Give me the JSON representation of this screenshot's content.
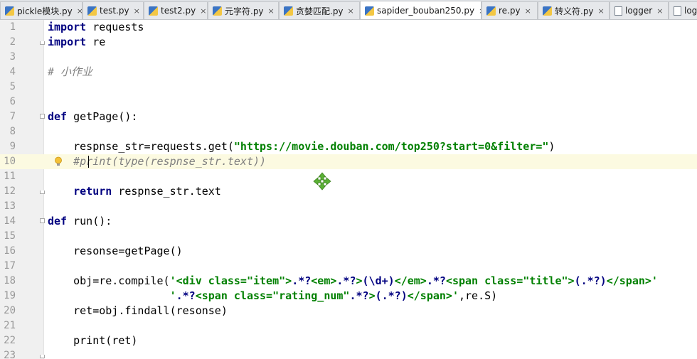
{
  "tabs": [
    {
      "label": "pickle模块.py",
      "type": "py",
      "active": false
    },
    {
      "label": "test.py",
      "type": "py",
      "active": false
    },
    {
      "label": "test2.py",
      "type": "py",
      "active": false
    },
    {
      "label": "元字符.py",
      "type": "py",
      "active": false
    },
    {
      "label": "贪婪匹配.py",
      "type": "py",
      "active": false
    },
    {
      "label": "sapider_bouban250.py",
      "type": "py",
      "active": true
    },
    {
      "label": "re.py",
      "type": "py",
      "active": false
    },
    {
      "label": "转义符.py",
      "type": "py",
      "active": false
    },
    {
      "label": "logger",
      "type": "file",
      "active": false
    },
    {
      "label": "log",
      "type": "file",
      "active": false
    }
  ],
  "tab_close_glyph": "×",
  "editor": {
    "current_line": 10,
    "lines": [
      {
        "n": "1",
        "segs": [
          {
            "t": "import",
            "c": "kw"
          },
          {
            "t": " requests",
            "c": ""
          }
        ]
      },
      {
        "n": "2",
        "segs": [
          {
            "t": "import",
            "c": "kw"
          },
          {
            "t": " re",
            "c": ""
          }
        ]
      },
      {
        "n": "3",
        "segs": []
      },
      {
        "n": "4",
        "segs": [
          {
            "t": "# 小作业",
            "c": "cmt"
          }
        ]
      },
      {
        "n": "5",
        "segs": []
      },
      {
        "n": "6",
        "segs": []
      },
      {
        "n": "7",
        "segs": [
          {
            "t": "def",
            "c": "kw"
          },
          {
            "t": " getPage():",
            "c": ""
          }
        ]
      },
      {
        "n": "8",
        "segs": []
      },
      {
        "n": "9",
        "segs": [
          {
            "t": "    respnse_str=requests.get(",
            "c": ""
          },
          {
            "t": "\"https://movie.douban.com/top250?start=0&filter=\"",
            "c": "str"
          },
          {
            "t": ")",
            "c": ""
          }
        ]
      },
      {
        "n": "10",
        "segs": [
          {
            "t": "    #print(type(respnse_str.text))",
            "c": "cmt"
          }
        ]
      },
      {
        "n": "11",
        "segs": []
      },
      {
        "n": "12",
        "segs": [
          {
            "t": "    ",
            "c": ""
          },
          {
            "t": "return",
            "c": "kw"
          },
          {
            "t": " respnse_str.text",
            "c": ""
          }
        ]
      },
      {
        "n": "13",
        "segs": []
      },
      {
        "n": "14",
        "segs": [
          {
            "t": "def",
            "c": "kw"
          },
          {
            "t": " run():",
            "c": ""
          }
        ]
      },
      {
        "n": "15",
        "segs": []
      },
      {
        "n": "16",
        "segs": [
          {
            "t": "    resonse=getPage()",
            "c": ""
          }
        ]
      },
      {
        "n": "17",
        "segs": []
      },
      {
        "n": "18",
        "segs": [
          {
            "t": "    obj=re.compile(",
            "c": ""
          },
          {
            "t": "'<div class=\"item\">",
            "c": "str"
          },
          {
            "t": ".*?",
            "c": "kw"
          },
          {
            "t": "<em>",
            "c": "str"
          },
          {
            "t": ".*?",
            "c": "kw"
          },
          {
            "t": ">",
            "c": "str"
          },
          {
            "t": "(\\d+)",
            "c": "kw"
          },
          {
            "t": "</em>",
            "c": "str"
          },
          {
            "t": ".*?",
            "c": "kw"
          },
          {
            "t": "<span class=\"title\">",
            "c": "str"
          },
          {
            "t": "(.*?)",
            "c": "kw"
          },
          {
            "t": "</span>'",
            "c": "str"
          }
        ]
      },
      {
        "n": "19",
        "segs": [
          {
            "t": "                   ",
            "c": ""
          },
          {
            "t": "'",
            "c": "str"
          },
          {
            "t": ".*?",
            "c": "kw"
          },
          {
            "t": "<span class=\"rating_num\"",
            "c": "str"
          },
          {
            "t": ".*?",
            "c": "kw"
          },
          {
            "t": ">",
            "c": "str"
          },
          {
            "t": "(.*?)",
            "c": "kw"
          },
          {
            "t": "</span>'",
            "c": "str"
          },
          {
            "t": ",re.S)",
            "c": ""
          }
        ]
      },
      {
        "n": "20",
        "segs": [
          {
            "t": "    ret=obj.findall(resonse)",
            "c": ""
          }
        ]
      },
      {
        "n": "21",
        "segs": []
      },
      {
        "n": "22",
        "segs": [
          {
            "t": "    print(ret)",
            "c": ""
          }
        ]
      },
      {
        "n": "23",
        "segs": []
      }
    ]
  },
  "colors": {
    "keyword": "#000080",
    "string": "#008000",
    "comment": "#808080",
    "current_line": "#fcfae1",
    "move_cursor": "#5bb135"
  },
  "icons": {
    "gutter": "intention-bulb-icon",
    "cursor": "move-cursor-icon",
    "fold": "fold-marker-icon"
  }
}
